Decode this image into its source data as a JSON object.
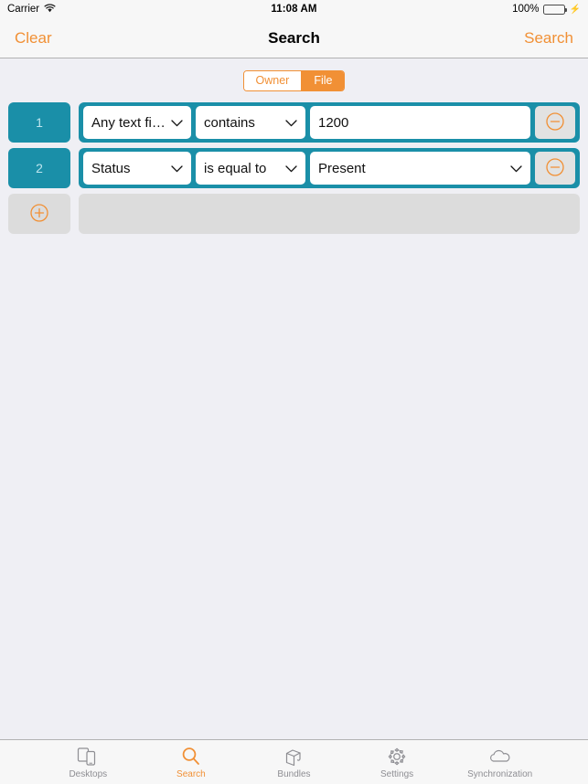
{
  "statusbar": {
    "carrier": "Carrier",
    "wifi_icon": "wifi-icon",
    "time": "11:08 AM",
    "battery_percent": "100%",
    "battery_level": 100,
    "charging_icon": "charging-bolt-icon"
  },
  "navbar": {
    "left_button": "Clear",
    "title": "Search",
    "right_button": "Search"
  },
  "segmented": {
    "options": [
      {
        "label": "Owner",
        "selected": false
      },
      {
        "label": "File",
        "selected": true
      }
    ]
  },
  "criteria": {
    "rows": [
      {
        "number": "1",
        "attribute": "Any text field",
        "operator": "contains",
        "value": "1200",
        "value_type": "text",
        "remove_icon": "minus-circle-icon"
      },
      {
        "number": "2",
        "attribute": "Status",
        "operator": "is equal to",
        "value": "Present",
        "value_type": "select",
        "remove_icon": "minus-circle-icon"
      }
    ],
    "add_row": {
      "add_icon": "plus-circle-icon",
      "placeholder_label": ""
    },
    "chevron_icon": "chevron-down-icon"
  },
  "tabbar": {
    "tabs": [
      {
        "label": "Desktops",
        "icon": "devices-icon",
        "active": false
      },
      {
        "label": "Search",
        "icon": "search-icon",
        "active": true
      },
      {
        "label": "Bundles",
        "icon": "bundle-box-icon",
        "active": false
      },
      {
        "label": "Settings",
        "icon": "gear-icon",
        "active": false
      },
      {
        "label": "Synchronization",
        "icon": "cloud-icon",
        "active": false
      }
    ]
  },
  "colors": {
    "accent_orange": "#f19035",
    "teal": "#1a8fa8",
    "background": "#efeff4",
    "bar_background": "#f7f7f7",
    "inactive_gray": "#8e8e93",
    "battery_green": "#4cd964"
  }
}
